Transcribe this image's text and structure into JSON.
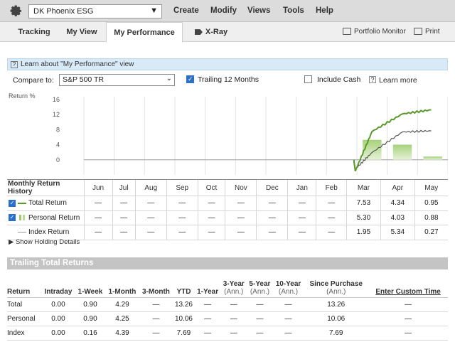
{
  "topbar": {
    "portfolio": "DK Phoenix ESG",
    "menu": [
      "Create",
      "Modify",
      "Views",
      "Tools",
      "Help"
    ]
  },
  "tabs": [
    "Tracking",
    "My View",
    "My Performance",
    "X-Ray"
  ],
  "active_tab": "My Performance",
  "tools": {
    "portfolio_monitor": "Portfolio Monitor",
    "print": "Print"
  },
  "info": {
    "learn_link": "Learn about \"My Performance\" view"
  },
  "compare": {
    "label": "Compare to:",
    "selected": "S&P 500 TR",
    "trailing_label": "Trailing 12 Months",
    "trailing_checked": true,
    "include_cash_label": "Include Cash",
    "include_cash_checked": false,
    "learn_more": "Learn more"
  },
  "colors": {
    "portfolio_line": "#5a9a2c",
    "index_line": "#555555",
    "bar": "#a6d27a",
    "accent": "#2a6fc9"
  },
  "chart_data": {
    "type": "line",
    "ylabel": "Return %",
    "y_ticks": [
      16,
      12,
      8,
      4,
      0
    ],
    "ylim": [
      -4,
      16
    ],
    "months": [
      "Jun",
      "Jul",
      "Aug",
      "Sep",
      "Oct",
      "Nov",
      "Dec",
      "Jan",
      "Feb",
      "Mar",
      "Apr",
      "May"
    ],
    "series": [
      {
        "name": "Total Return",
        "kind": "line",
        "color": "#5a9a2c",
        "values": [
          null,
          null,
          null,
          null,
          null,
          null,
          null,
          null,
          -3.0,
          7.53,
          12.19,
          13.26
        ]
      },
      {
        "name": "Personal Return",
        "kind": "bar",
        "color": "#a6d27a",
        "values": [
          null,
          null,
          null,
          null,
          null,
          null,
          null,
          null,
          null,
          5.3,
          4.03,
          0.88
        ]
      },
      {
        "name": "Index Return",
        "kind": "line",
        "color": "#555555",
        "values": [
          null,
          null,
          null,
          null,
          null,
          null,
          null,
          null,
          -2.5,
          1.95,
          7.4,
          7.69
        ]
      }
    ]
  },
  "monthly": {
    "title": "Monthly Return History",
    "months": [
      "Jun",
      "Jul",
      "Aug",
      "Sep",
      "Oct",
      "Nov",
      "Dec",
      "Jan",
      "Feb",
      "Mar",
      "Apr",
      "May"
    ],
    "rows": [
      {
        "label": "Total Return",
        "checked": true,
        "values": [
          "—",
          "—",
          "—",
          "—",
          "—",
          "—",
          "—",
          "—",
          "—",
          "7.53",
          "4.34",
          "0.95"
        ]
      },
      {
        "label": "Personal Return",
        "checked": true,
        "values": [
          "—",
          "—",
          "—",
          "—",
          "—",
          "—",
          "—",
          "—",
          "—",
          "5.30",
          "4.03",
          "0.88"
        ]
      },
      {
        "label": "Index Return",
        "checked": false,
        "values": [
          "—",
          "—",
          "—",
          "—",
          "—",
          "—",
          "—",
          "—",
          "—",
          "1.95",
          "5.34",
          "0.27"
        ]
      }
    ]
  },
  "show_holding": "Show Holding Details",
  "trailing": {
    "title": "Trailing Total Returns",
    "headers": [
      {
        "main": "Return",
        "sub": ""
      },
      {
        "main": "Intraday",
        "sub": ""
      },
      {
        "main": "1-Week",
        "sub": ""
      },
      {
        "main": "1-Month",
        "sub": ""
      },
      {
        "main": "3-Month",
        "sub": ""
      },
      {
        "main": "YTD",
        "sub": ""
      },
      {
        "main": "1-Year",
        "sub": ""
      },
      {
        "main": "3-Year",
        "sub": "(Ann.)"
      },
      {
        "main": "5-Year",
        "sub": "(Ann.)"
      },
      {
        "main": "10-Year",
        "sub": "(Ann.)"
      },
      {
        "main": "Since Purchase",
        "sub": "(Ann.)"
      },
      {
        "main": "Enter Custom Time",
        "sub": ""
      }
    ],
    "rows": [
      [
        "Total",
        "0.00",
        "0.90",
        "4.29",
        "—",
        "13.26",
        "—",
        "—",
        "—",
        "—",
        "13.26",
        "—"
      ],
      [
        "Personal",
        "0.00",
        "0.90",
        "4.25",
        "—",
        "10.06",
        "—",
        "—",
        "—",
        "—",
        "10.06",
        "—"
      ],
      [
        "Index",
        "0.00",
        "0.16",
        "4.39",
        "—",
        "7.69",
        "—",
        "—",
        "—",
        "—",
        "7.69",
        "—"
      ]
    ]
  }
}
